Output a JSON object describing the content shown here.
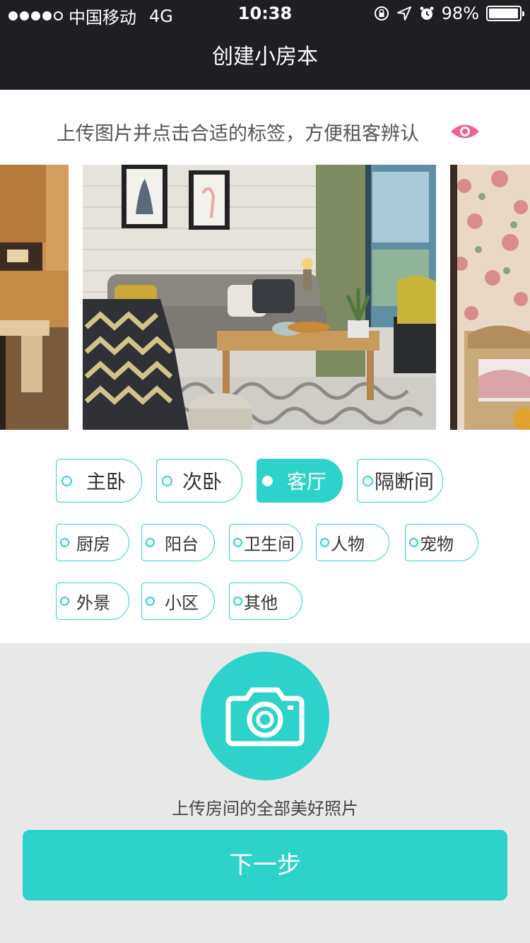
{
  "status": {
    "carrier": "中国移动",
    "network": "4G",
    "time": "10:38",
    "battery": "98%",
    "battery_level": 0.98
  },
  "nav": {
    "title": "创建小房本"
  },
  "hint": "上传图片并点击合适的标签，方便租客辨认",
  "tags": {
    "master_bedroom": "主卧",
    "second_bedroom": "次卧",
    "living_room": "客厅",
    "partition_room": "隔断间",
    "kitchen": "厨房",
    "balcony": "阳台",
    "bathroom": "卫生间",
    "people": "人物",
    "pet": "宠物",
    "exterior": "外景",
    "community": "小区",
    "other": "其他",
    "selected": "客厅"
  },
  "upload": {
    "label": "上传房间的全部美好照片"
  },
  "next_button": "下一步",
  "colors": {
    "accent": "#2dd3cb",
    "navbar": "#1f1e23",
    "eye_icon": "#f06292",
    "page_bg": "#e8e8e8"
  }
}
